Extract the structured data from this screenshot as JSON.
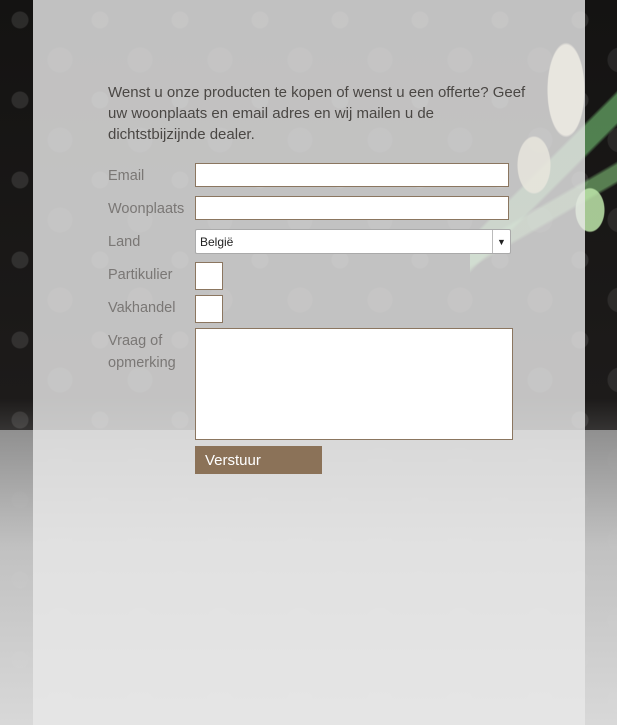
{
  "form": {
    "intro": "Wenst u onze producten te kopen of wenst u een offerte? Geef uw woonplaats en email adres en wij mailen u de dichtstbijzijnde dealer.",
    "email_label": "Email",
    "email_value": "",
    "woonplaats_label": "Woonplaats",
    "woonplaats_value": "",
    "land_label": "Land",
    "land_selected": "België",
    "partikulier_label": "Partikulier",
    "partikulier_checked": false,
    "vakhandel_label": "Vakhandel",
    "vakhandel_checked": false,
    "vraag_label_line1": "Vraag of",
    "vraag_label_line2": "opmerking",
    "vraag_value": "",
    "submit_label": "Verstuur"
  },
  "colors": {
    "panel": "#e8e8e8",
    "button": "#8b7258",
    "field_border": "#8b7660",
    "label_text": "#7a7775"
  }
}
